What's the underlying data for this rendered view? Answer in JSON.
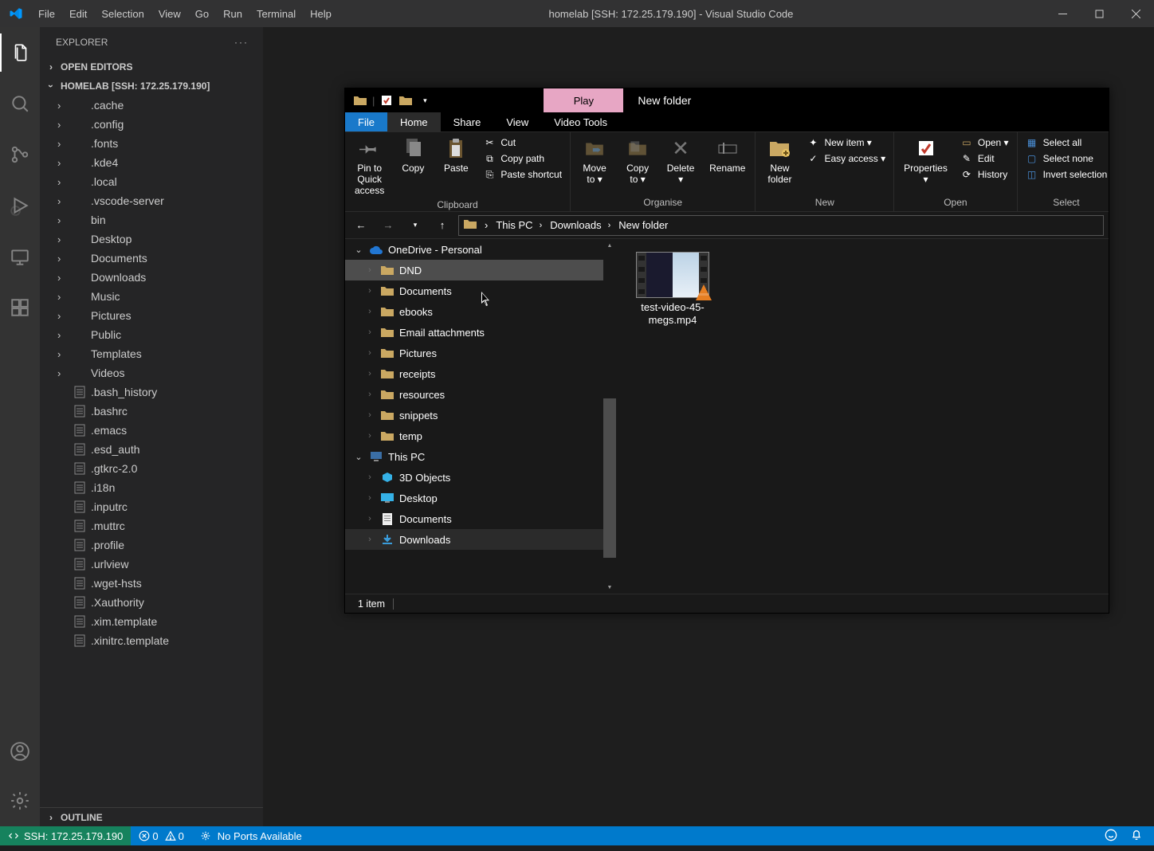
{
  "window_title": "homelab [SSH: 172.25.179.190] - Visual Studio Code",
  "menu": [
    "File",
    "Edit",
    "Selection",
    "View",
    "Go",
    "Run",
    "Terminal",
    "Help"
  ],
  "explorer_label": "EXPLORER",
  "sections": {
    "open_editors": "OPEN EDITORS",
    "workspace": "HOMELAB [SSH: 172.25.179.190]",
    "outline": "OUTLINE"
  },
  "tree": [
    {
      "name": ".cache",
      "type": "folder"
    },
    {
      "name": ".config",
      "type": "folder"
    },
    {
      "name": ".fonts",
      "type": "folder"
    },
    {
      "name": ".kde4",
      "type": "folder"
    },
    {
      "name": ".local",
      "type": "folder"
    },
    {
      "name": ".vscode-server",
      "type": "folder"
    },
    {
      "name": "bin",
      "type": "folder"
    },
    {
      "name": "Desktop",
      "type": "folder"
    },
    {
      "name": "Documents",
      "type": "folder"
    },
    {
      "name": "Downloads",
      "type": "folder"
    },
    {
      "name": "Music",
      "type": "folder"
    },
    {
      "name": "Pictures",
      "type": "folder"
    },
    {
      "name": "Public",
      "type": "folder"
    },
    {
      "name": "Templates",
      "type": "folder"
    },
    {
      "name": "Videos",
      "type": "folder"
    },
    {
      "name": ".bash_history",
      "type": "file"
    },
    {
      "name": ".bashrc",
      "type": "file"
    },
    {
      "name": ".emacs",
      "type": "file"
    },
    {
      "name": ".esd_auth",
      "type": "file"
    },
    {
      "name": ".gtkrc-2.0",
      "type": "file"
    },
    {
      "name": ".i18n",
      "type": "file"
    },
    {
      "name": ".inputrc",
      "type": "file"
    },
    {
      "name": ".muttrc",
      "type": "file"
    },
    {
      "name": ".profile",
      "type": "file"
    },
    {
      "name": ".urlview",
      "type": "file"
    },
    {
      "name": ".wget-hsts",
      "type": "file"
    },
    {
      "name": ".Xauthority",
      "type": "file"
    },
    {
      "name": ".xim.template",
      "type": "file"
    },
    {
      "name": ".xinitrc.template",
      "type": "file"
    }
  ],
  "status": {
    "remote": "SSH: 172.25.179.190",
    "errors": "0",
    "warnings": "0",
    "ports": "No Ports Available"
  },
  "fe": {
    "title": "New folder",
    "media_tab": "Play",
    "tabs": [
      "File",
      "Home",
      "Share",
      "View",
      "Video Tools"
    ],
    "ribbon": {
      "clipboard": {
        "label": "Clipboard",
        "pin": "Pin to Quick\naccess",
        "copy": "Copy",
        "paste": "Paste",
        "cut": "Cut",
        "copy_path": "Copy path",
        "paste_shortcut": "Paste shortcut"
      },
      "organise": {
        "label": "Organise",
        "move_to": "Move\nto ▾",
        "copy_to": "Copy\nto ▾",
        "delete": "Delete\n▾",
        "rename": "Rename"
      },
      "new": {
        "label": "New",
        "new_folder": "New\nfolder",
        "new_item": "New item ▾",
        "easy_access": "Easy access ▾"
      },
      "open": {
        "label": "Open",
        "properties": "Properties\n▾",
        "open": "Open ▾",
        "edit": "Edit",
        "history": "History"
      },
      "select": {
        "label": "Select",
        "select_all": "Select all",
        "select_none": "Select none",
        "invert": "Invert selection"
      }
    },
    "breadcrumb": [
      "This PC",
      "Downloads",
      "New folder"
    ],
    "nav": [
      {
        "label": "OneDrive - Personal",
        "depth": 1,
        "expand": "v",
        "icon": "cloud",
        "selected": false
      },
      {
        "label": "DND",
        "depth": 2,
        "expand": "",
        "icon": "folder",
        "selected": true
      },
      {
        "label": "Documents",
        "depth": 2,
        "expand": "",
        "icon": "folder"
      },
      {
        "label": "ebooks",
        "depth": 2,
        "expand": "",
        "icon": "folder"
      },
      {
        "label": "Email attachments",
        "depth": 2,
        "expand": "",
        "icon": "folder"
      },
      {
        "label": "Pictures",
        "depth": 2,
        "expand": "",
        "icon": "folder"
      },
      {
        "label": "receipts",
        "depth": 2,
        "expand": "",
        "icon": "folder"
      },
      {
        "label": "resources",
        "depth": 2,
        "expand": "",
        "icon": "folder"
      },
      {
        "label": "snippets",
        "depth": 2,
        "expand": "",
        "icon": "folder"
      },
      {
        "label": "temp",
        "depth": 2,
        "expand": "",
        "icon": "folder"
      },
      {
        "label": "This PC",
        "depth": 1,
        "expand": "v",
        "icon": "pc"
      },
      {
        "label": "3D Objects",
        "depth": 2,
        "expand": "",
        "icon": "3d"
      },
      {
        "label": "Desktop",
        "depth": 2,
        "expand": "",
        "icon": "desktop"
      },
      {
        "label": "Documents",
        "depth": 2,
        "expand": "",
        "icon": "doc"
      },
      {
        "label": "Downloads",
        "depth": 2,
        "expand": "",
        "icon": "download",
        "selectable": true
      }
    ],
    "file": {
      "name": "test-video-45-megs.mp4"
    },
    "status": "1 item"
  }
}
